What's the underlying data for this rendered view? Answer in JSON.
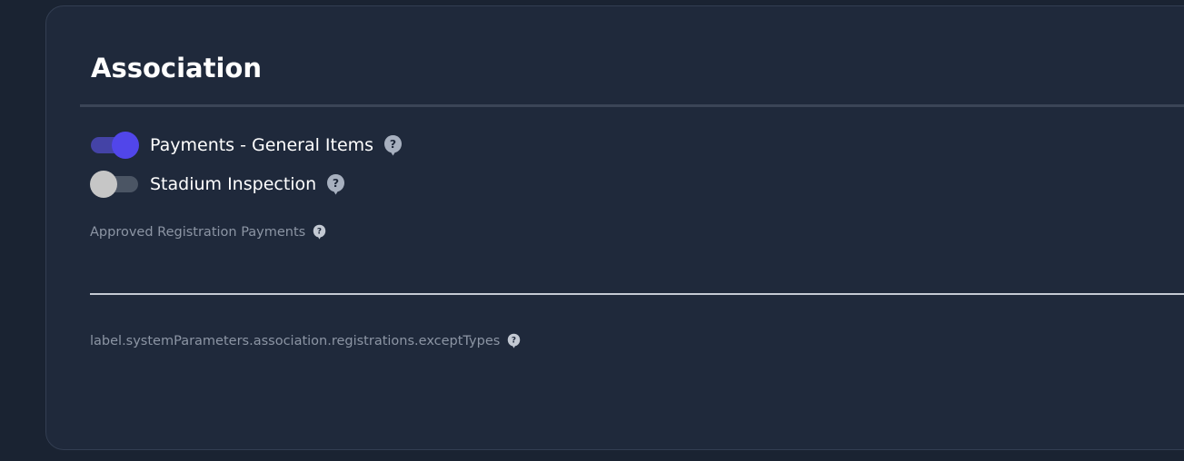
{
  "section": {
    "title": "Association"
  },
  "toggles": [
    {
      "label": "Payments - General Items",
      "enabled": true
    },
    {
      "label": "Stadium Inspection",
      "enabled": false
    }
  ],
  "fields": {
    "approved_registration_payments": {
      "label": "Approved Registration Payments",
      "value": ""
    },
    "except_types": {
      "label": "label.systemParameters.association.registrations.exceptTypes"
    }
  },
  "colors": {
    "page_background": "#1a2332",
    "card_background": "#1f293b",
    "accent": "#5146ea",
    "text_primary": "#ffffff",
    "text_muted": "#8c95a4",
    "help_icon": "#a7b0bf"
  },
  "icons": {
    "help": "question-circle-icon"
  }
}
